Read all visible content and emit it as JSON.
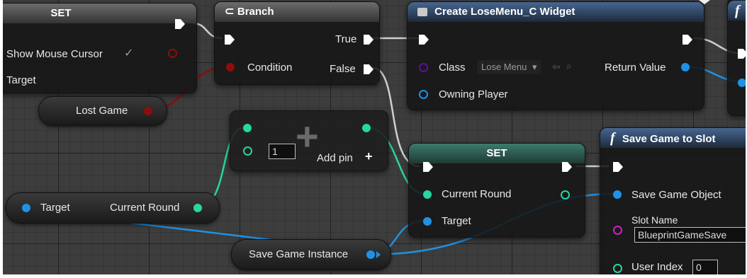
{
  "colors": {
    "exec": "#ffffff",
    "bool": "#8c0d0d",
    "object": "#1e92e6",
    "integer": "#27d6a0",
    "class": "#5b0fa0",
    "string": "#d11ec8"
  },
  "set_node_1": {
    "title": "SET",
    "show_mouse_cursor_label": "Show Mouse Cursor",
    "checkbox": "✓",
    "target_label": "Target"
  },
  "lost_game_var": {
    "label": "Lost Game"
  },
  "branch_node": {
    "title": "Branch",
    "condition_label": "Condition",
    "true_label": "True",
    "false_label": "False"
  },
  "create_widget_node": {
    "title": "Create LoseMenu_C Widget",
    "class_label": "Class",
    "class_value": "Lose Menu",
    "owning_player_label": "Owning Player",
    "return_value_label": "Return Value"
  },
  "add_node": {
    "index_value": "1",
    "add_pin_label": "Add pin",
    "plus_symbol": "+"
  },
  "get_current_round": {
    "target_label": "Target",
    "output_label": "Current Round"
  },
  "set_node_2": {
    "title": "SET",
    "current_round_label": "Current Round",
    "target_label": "Target"
  },
  "save_game_instance_var": {
    "label": "Save Game Instance"
  },
  "save_game_node": {
    "function_icon": "f",
    "title": "Save Game to Slot",
    "save_game_object_label": "Save Game Object",
    "slot_name_label": "Slot Name",
    "slot_name_value": "BlueprintGameSave",
    "user_index_label": "User Index",
    "user_index_value": "0"
  },
  "partial_node_right": {
    "function_icon": "f"
  }
}
